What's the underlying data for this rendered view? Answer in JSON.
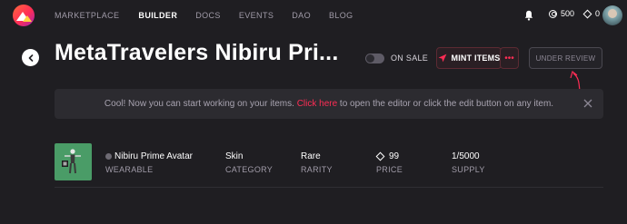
{
  "nav": {
    "items": [
      {
        "label": "MARKETPLACE",
        "active": false
      },
      {
        "label": "BUILDER",
        "active": true
      },
      {
        "label": "DOCS",
        "active": false
      },
      {
        "label": "EVENTS",
        "active": false
      },
      {
        "label": "DAO",
        "active": false
      },
      {
        "label": "BLOG",
        "active": false
      }
    ],
    "mana_balance": "500",
    "mana_polygon_balance": "0",
    "icons": {
      "logo": "decentraland-logo",
      "bell": "bell-icon",
      "mana": "mana-icon",
      "polygon": "diamond-icon"
    }
  },
  "header": {
    "title": "MetaTravelers Nibiru Pri...",
    "on_sale_label": "ON SALE",
    "on_sale_enabled": false,
    "mint_label": "MINT ITEMS",
    "more_label": "•••",
    "review_label": "UNDER REVIEW"
  },
  "notice": {
    "text_before": "Cool! Now you can start working on your items. ",
    "link_text": "Click here",
    "text_after": " to open the editor or click the edit button on any item."
  },
  "item": {
    "name": "Nibiru Prime Avatar",
    "type": "WEARABLE",
    "category_value": "Skin",
    "category_label": "CATEGORY",
    "rarity_value": "Rare",
    "rarity_label": "RARITY",
    "price_value": "99",
    "price_label": "PRICE",
    "supply_value": "1/5000",
    "supply_label": "SUPPLY"
  },
  "colors": {
    "background": "#1f1e22",
    "accent": "#ff2d55",
    "banner": "#2c2b30",
    "thumb": "#4a9c67"
  }
}
